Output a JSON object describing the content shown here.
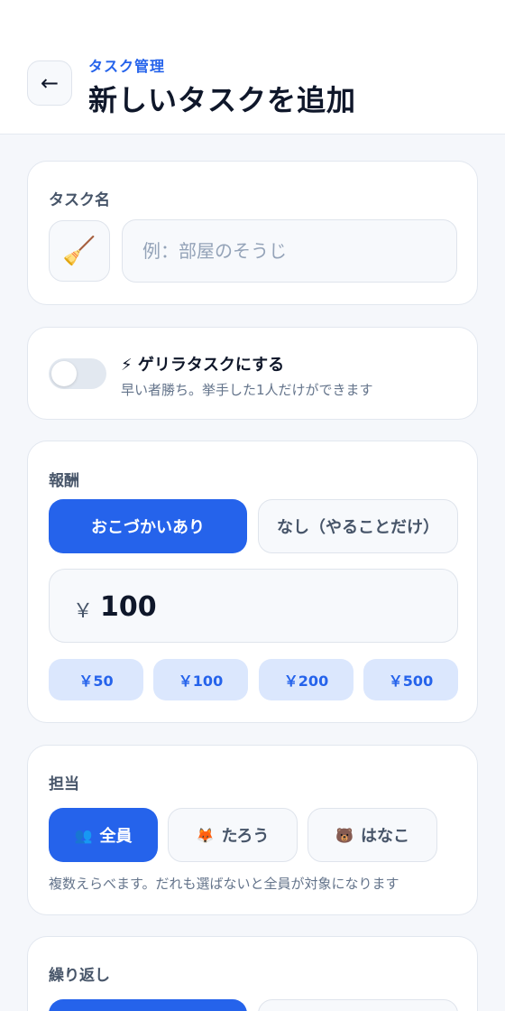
{
  "header": {
    "back_icon": "←",
    "subtitle": "タスク管理",
    "title": "新しいタスクを追加"
  },
  "task_name": {
    "label": "タスク名",
    "emoji": "🧹",
    "placeholder": "例：部屋のそうじ",
    "value": ""
  },
  "guerrilla": {
    "enabled": false,
    "title": "⚡ ゲリラタスクにする",
    "description": "早い者勝ち。挙手した1人だけができます"
  },
  "reward": {
    "label": "報酬",
    "options": [
      "おこづかいあり",
      "なし（やることだけ）"
    ],
    "selected": "おこづかいあり",
    "currency": "￥",
    "amount": "100",
    "presets": [
      "￥50",
      "￥100",
      "￥200",
      "￥500"
    ]
  },
  "assignee": {
    "label": "担当",
    "options": [
      {
        "icon": "👥",
        "label": "全員"
      },
      {
        "icon": "🦊",
        "label": "たろう"
      },
      {
        "icon": "🐻",
        "label": "はなこ"
      }
    ],
    "selected": "全員",
    "hint": "複数えらべます。だれも選ばないと全員が対象になります"
  },
  "repeat": {
    "label": "繰り返し"
  },
  "colors": {
    "accent": "#2563eb",
    "chip_bg": "#dbe7fd",
    "background": "#f5f7fb"
  }
}
